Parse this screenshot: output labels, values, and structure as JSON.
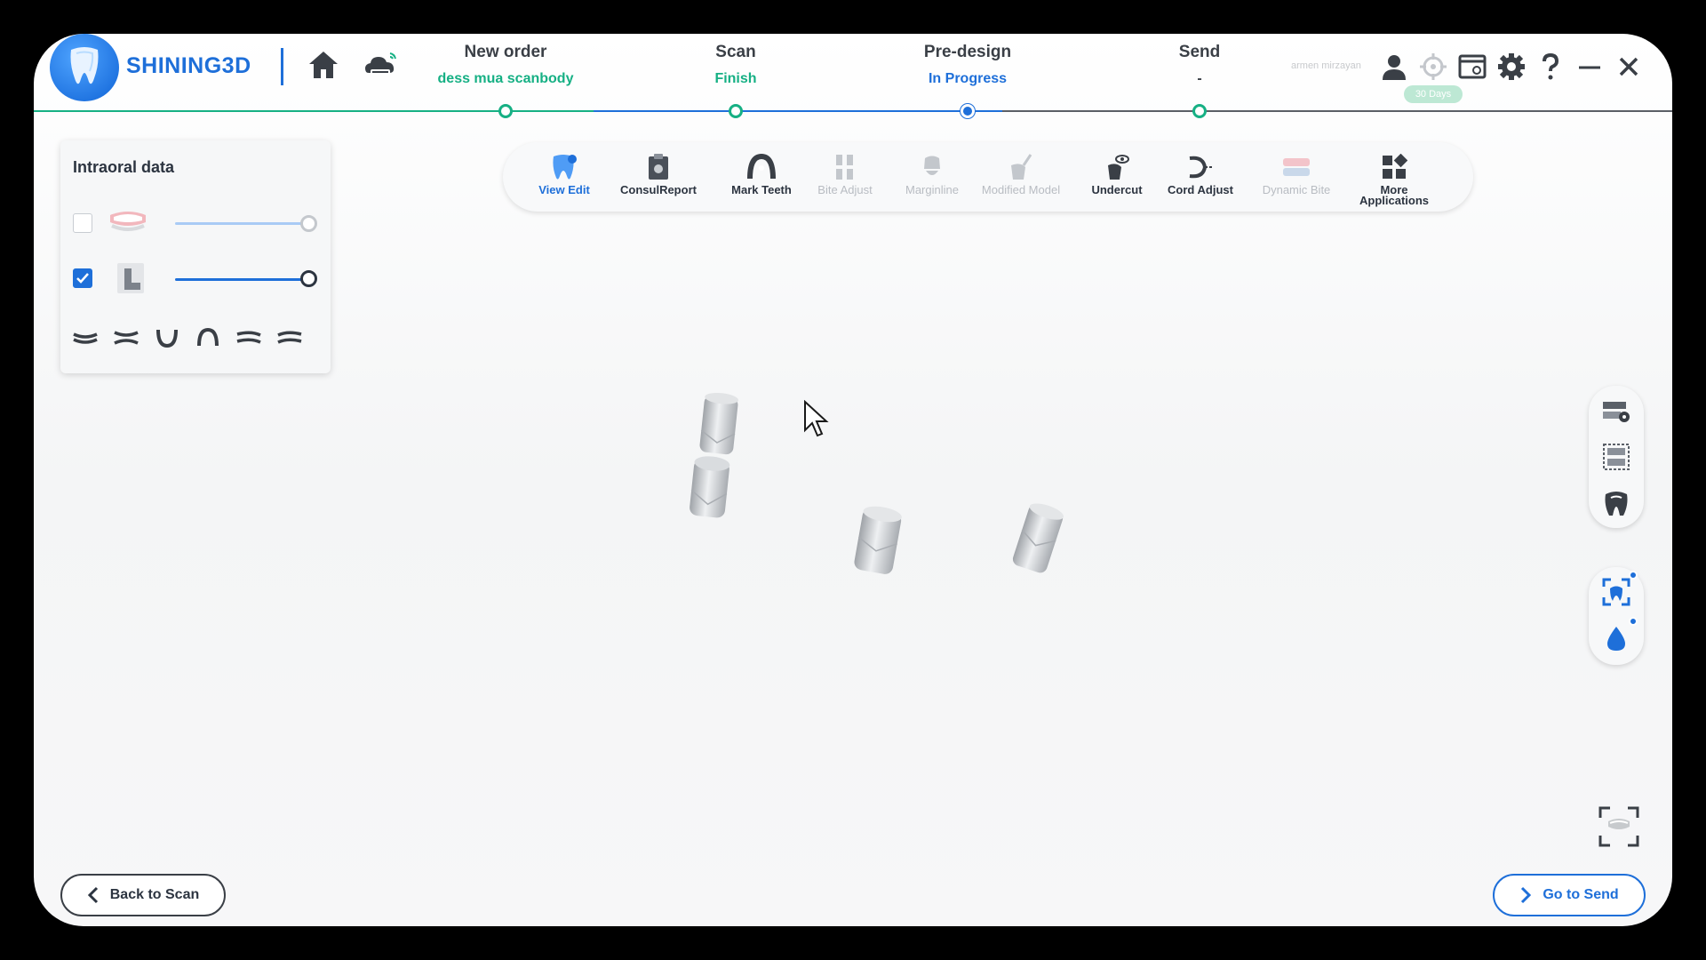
{
  "brand": {
    "name": "SHINING3D"
  },
  "steps": [
    {
      "title": "New order",
      "status": "dess mua scanbody"
    },
    {
      "title": "Scan",
      "status": "Finish"
    },
    {
      "title": "Pre-design",
      "status": "In Progress"
    },
    {
      "title": "Send",
      "status": "-"
    }
  ],
  "user": {
    "name": "armen mirzayan",
    "badge": "30 Days"
  },
  "toolbar": {
    "tools": [
      {
        "label": "View Edit",
        "state": "active"
      },
      {
        "label": "ConsulReport",
        "state": "enabled"
      },
      {
        "label": "Mark Teeth",
        "state": "enabled"
      },
      {
        "label": "Bite Adjust",
        "state": "disabled"
      },
      {
        "label": "Marginline",
        "state": "disabled"
      },
      {
        "label": "Modified Model",
        "state": "disabled"
      },
      {
        "label": "Undercut",
        "state": "enabled"
      },
      {
        "label": "Cord Adjust",
        "state": "enabled"
      },
      {
        "label": "Dynamic Bite",
        "state": "disabled"
      },
      {
        "label": "More Applications",
        "state": "enabled"
      }
    ]
  },
  "data_panel": {
    "title": "Intraoral data",
    "layers": [
      {
        "icon": "jaw-model-icon",
        "checked": false,
        "opacity": 1.0
      },
      {
        "icon": "scanbody-icon",
        "checked": true,
        "opacity": 1.0
      }
    ],
    "view_icons": [
      "upper-jaw-view-icon",
      "both-jaws-view-icon",
      "lower-arch-view-icon",
      "upper-arch-view-icon",
      "left-view-icon",
      "right-view-icon"
    ]
  },
  "side_tools": [
    "settings-view-icon",
    "grid-view-icon",
    "tooth-view-icon",
    "smart-view-icon",
    "water-drop-icon"
  ],
  "buttons": {
    "back": "Back to Scan",
    "send": "Go to Send"
  },
  "colors": {
    "accent": "#1e6fd9",
    "success": "#16b084",
    "disabled": "#b8bcc2"
  }
}
